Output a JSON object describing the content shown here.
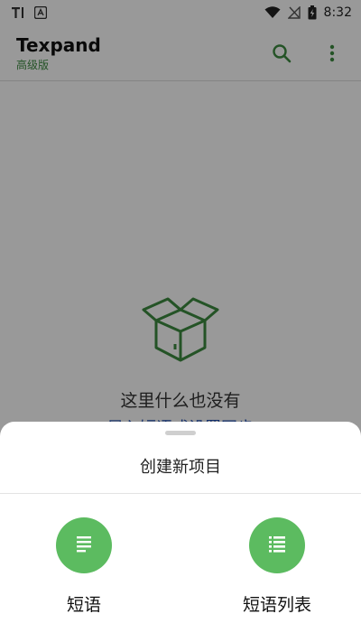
{
  "status_bar": {
    "time": "8:32",
    "icons": [
      "text-app-icon",
      "store-icon",
      "wifi-icon",
      "signal-icon",
      "battery-charging-icon"
    ]
  },
  "app_bar": {
    "title": "Texpand",
    "subtitle": "高级版",
    "actions": [
      "search-icon",
      "more-vert-icon"
    ]
  },
  "empty_state": {
    "icon": "open-box-icon",
    "message": "这里什么也没有",
    "link_text": "导入短语或设置同步"
  },
  "bottom_sheet": {
    "title": "创建新项目",
    "options": [
      {
        "label": "短语",
        "icon": "short-text-icon"
      },
      {
        "label": "短语列表",
        "icon": "list-icon"
      }
    ]
  },
  "colors": {
    "accent": "#3d8b40",
    "option_circle": "#5cbb60",
    "link": "#1e4fb3",
    "scrim": "rgba(0,0,0,0.40)"
  }
}
